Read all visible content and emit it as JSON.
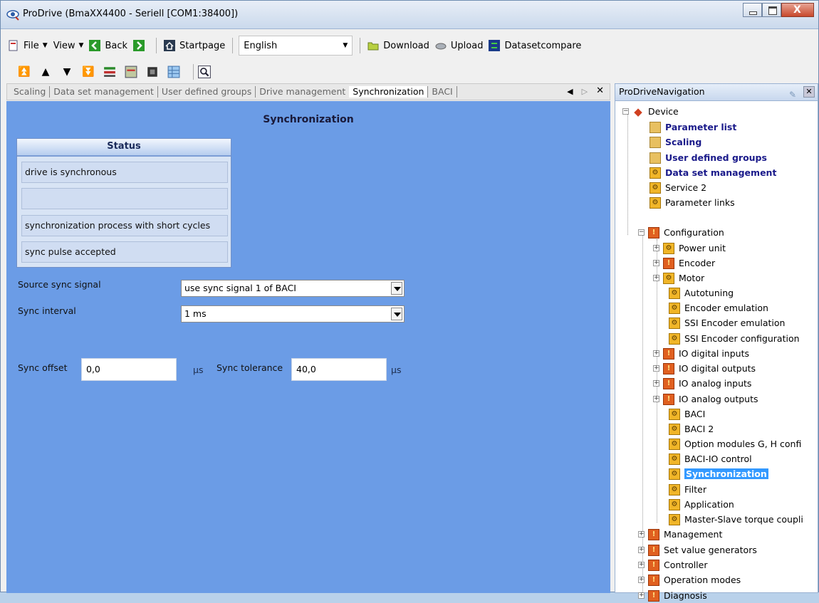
{
  "window": {
    "title": "ProDrive (BmaXX4400 - Seriell [COM1:38400])"
  },
  "toolbar": {
    "file": "File",
    "view": "View",
    "back": "Back",
    "startpage": "Startpage",
    "language": "English",
    "download": "Download",
    "upload": "Upload",
    "datasetcompare": "Datasetcompare"
  },
  "tabs": [
    {
      "label": "Scaling"
    },
    {
      "label": "Data set management"
    },
    {
      "label": "User defined groups"
    },
    {
      "label": "Drive management"
    },
    {
      "label": "Synchronization"
    },
    {
      "label": "BACI"
    }
  ],
  "page": {
    "title": "Synchronization",
    "status": {
      "header": "Status",
      "rows": [
        "drive is synchronous",
        "",
        "synchronization process with short cycles",
        "sync pulse accepted"
      ]
    },
    "source_sync_signal": {
      "label": "Source sync signal",
      "value": "use sync signal 1 of BACI"
    },
    "sync_interval": {
      "label": "Sync interval",
      "value": "1 ms"
    },
    "sync_offset": {
      "label": "Sync offset",
      "value": "0,0",
      "unit": "µs"
    },
    "sync_tolerance": {
      "label": "Sync tolerance",
      "value": "40,0",
      "unit": "µs"
    }
  },
  "nav": {
    "title": "ProDriveNavigation",
    "items": [
      {
        "label": "Device"
      },
      {
        "label": "Parameter list"
      },
      {
        "label": "Scaling"
      },
      {
        "label": "User defined groups"
      },
      {
        "label": "Data set management"
      },
      {
        "label": "Service 2"
      },
      {
        "label": "Parameter links"
      },
      {
        "label": "Configuration"
      },
      {
        "label": "Power unit"
      },
      {
        "label": "Encoder"
      },
      {
        "label": "Motor"
      },
      {
        "label": "Autotuning"
      },
      {
        "label": "Encoder emulation"
      },
      {
        "label": "SSI Encoder emulation"
      },
      {
        "label": "SSI Encoder configuration"
      },
      {
        "label": "IO digital inputs"
      },
      {
        "label": "IO digital outputs"
      },
      {
        "label": "IO analog inputs"
      },
      {
        "label": "IO analog outputs"
      },
      {
        "label": "BACI"
      },
      {
        "label": "BACI 2"
      },
      {
        "label": "Option modules G, H confi"
      },
      {
        "label": "BACI-IO control"
      },
      {
        "label": "Synchronization"
      },
      {
        "label": "Filter"
      },
      {
        "label": "Application"
      },
      {
        "label": "Master-Slave torque coupli"
      },
      {
        "label": "Management"
      },
      {
        "label": "Set value generators"
      },
      {
        "label": "Controller"
      },
      {
        "label": "Operation modes"
      },
      {
        "label": "Diagnosis"
      }
    ]
  }
}
